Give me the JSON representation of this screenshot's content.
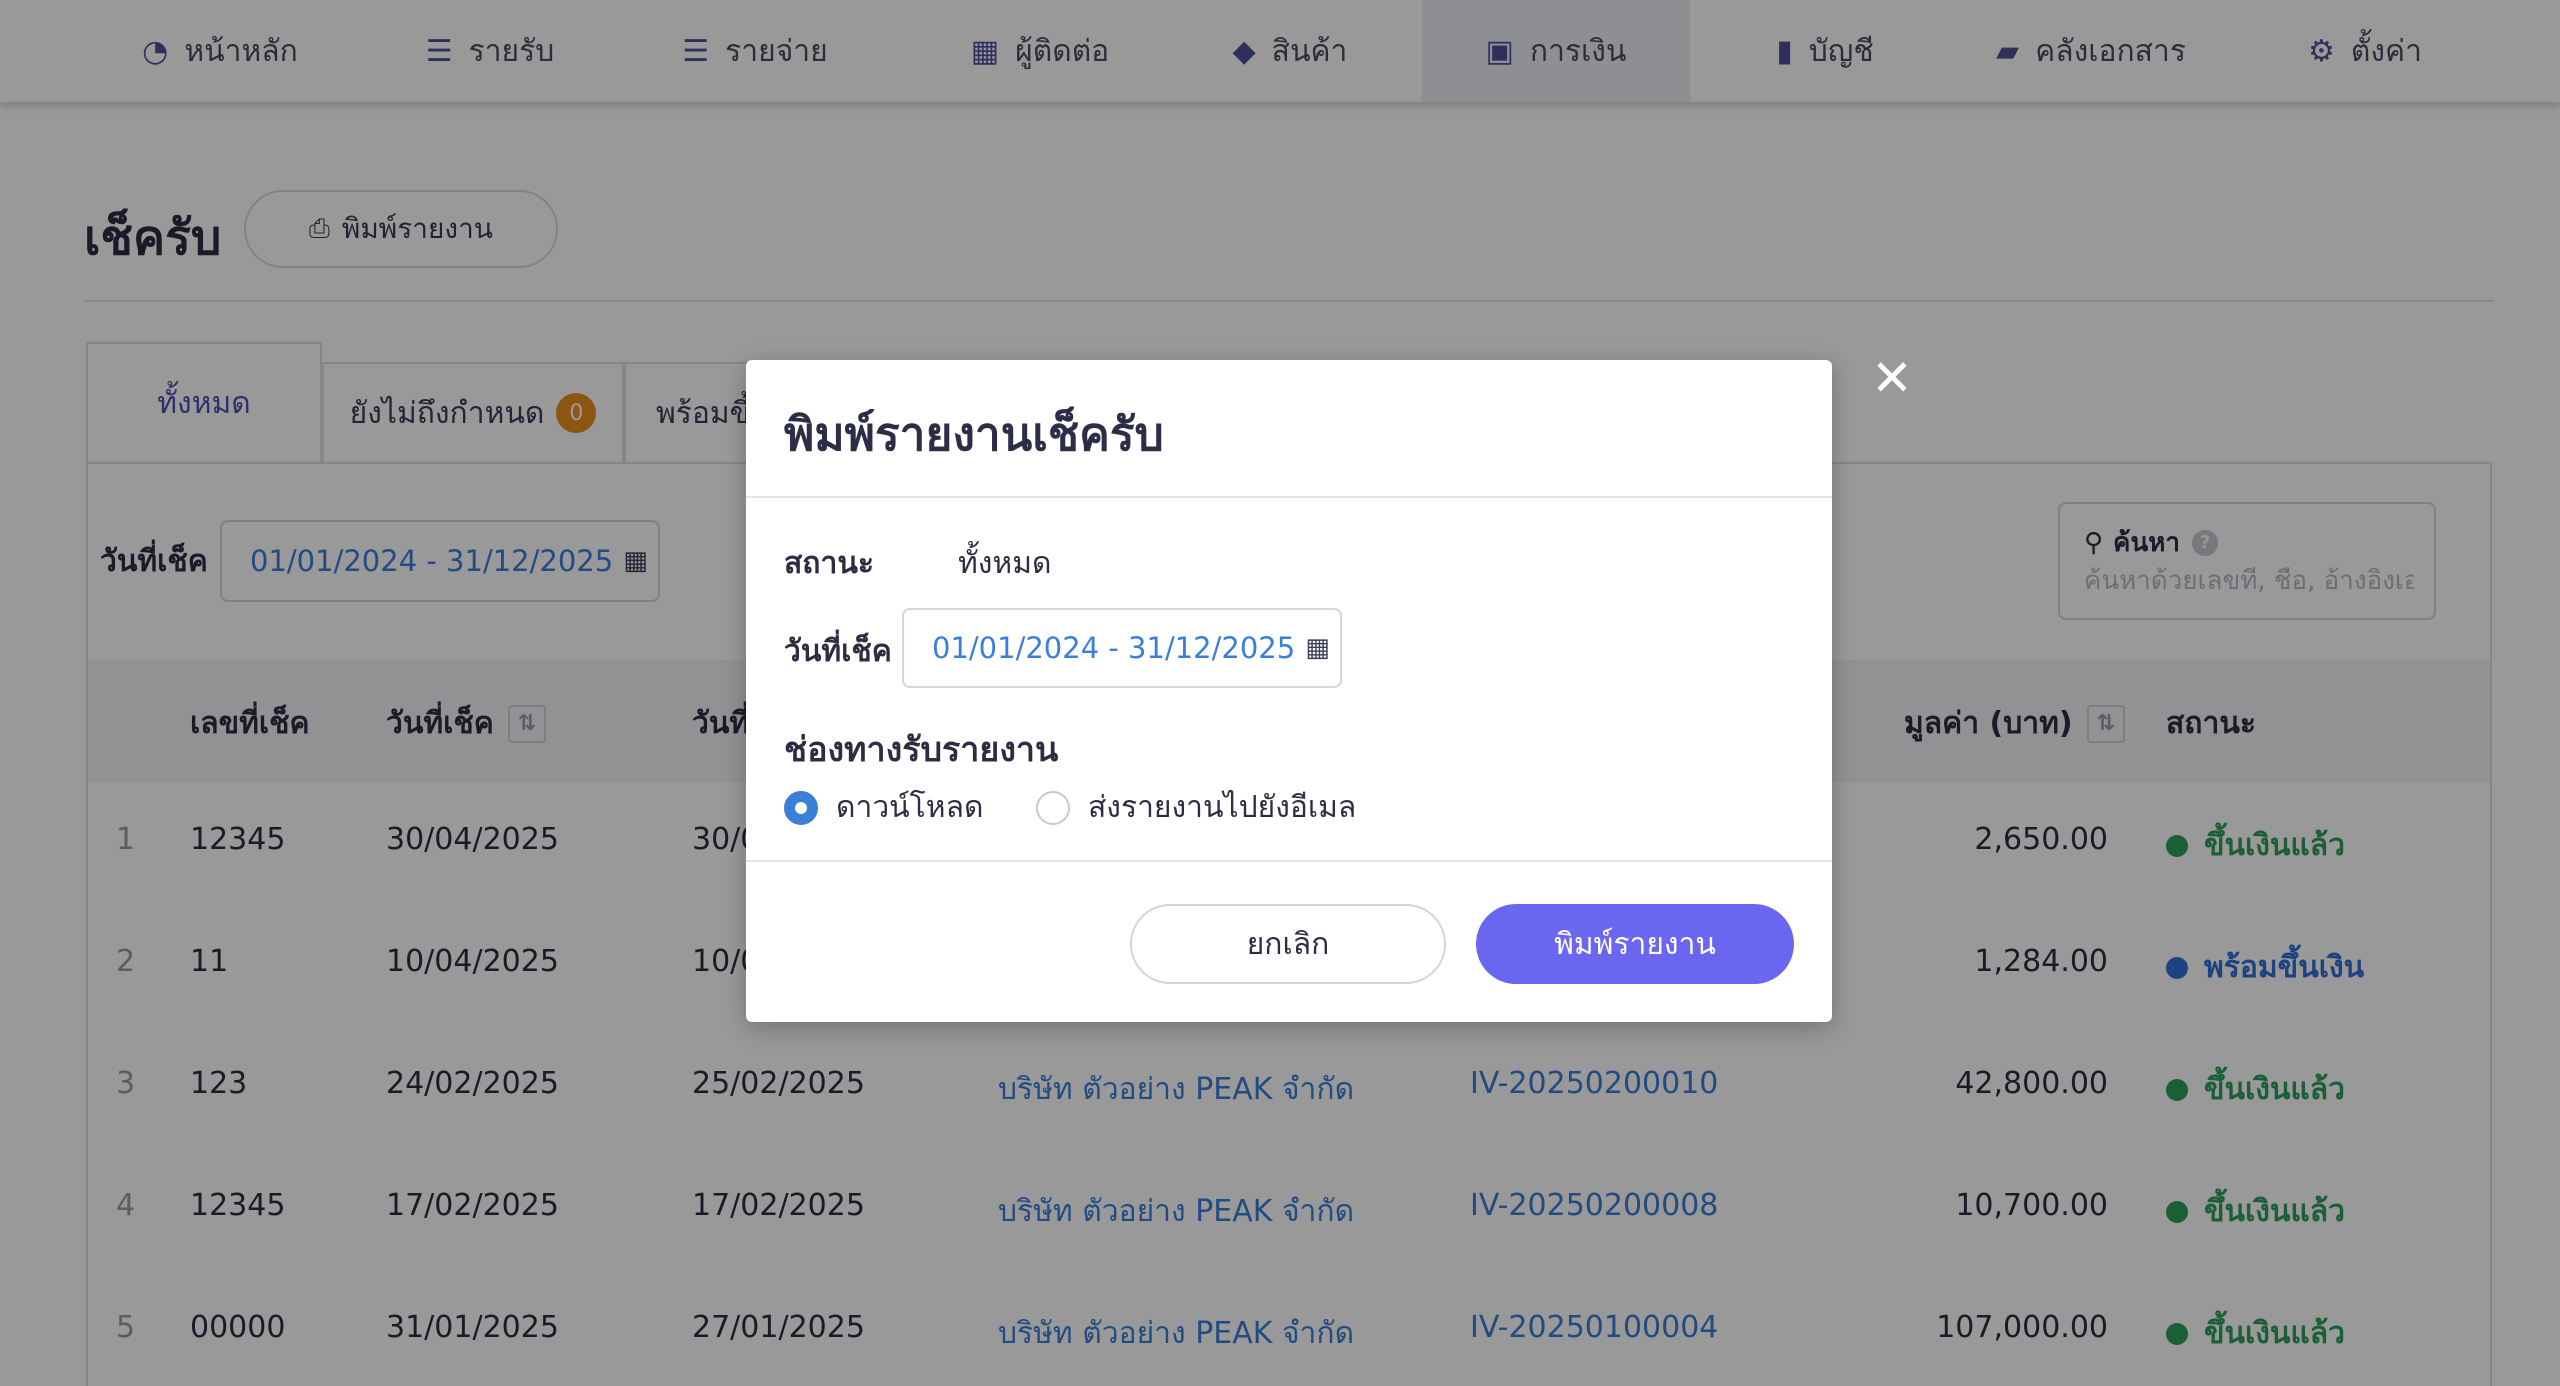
{
  "nav": {
    "items": [
      {
        "icon": "dashboard-icon",
        "glyph": "◔",
        "label": "หน้าหลัก"
      },
      {
        "icon": "income-icon",
        "glyph": "☰",
        "label": "รายรับ"
      },
      {
        "icon": "expense-icon",
        "glyph": "☰",
        "label": "รายจ่าย"
      },
      {
        "icon": "contacts-icon",
        "glyph": "▦",
        "label": "ผู้ติดต่อ"
      },
      {
        "icon": "product-box-icon",
        "glyph": "◆",
        "label": "สินค้า"
      },
      {
        "icon": "money-icon",
        "glyph": "▣",
        "label": "การเงิน",
        "active": true
      },
      {
        "icon": "ledger-book-icon",
        "glyph": "▮",
        "label": "บัญชี"
      },
      {
        "icon": "folder-icon",
        "glyph": "▰",
        "label": "คลังเอกสาร"
      },
      {
        "icon": "gear-icon",
        "glyph": "⚙",
        "label": "ตั้งค่า"
      }
    ]
  },
  "page": {
    "title": "เช็ครับ",
    "print_button": "พิมพ์รายงาน",
    "print_glyph": "⎙"
  },
  "tabs": {
    "all": "ทั้งหมด",
    "not_due": "ยังไม่ถึงกำหนด",
    "not_due_count": "0",
    "ready": "พร้อมขึ้"
  },
  "filter": {
    "date_label": "วันที่เช็ค",
    "date_range": "01/01/2024 - 31/12/2025",
    "search_label": "ค้นหา",
    "search_placeholder": "ค้นหาด้วยเลขที่, ชื่อ, อ้างอิงเอ"
  },
  "table": {
    "headers": {
      "check_no": "เลขที่เช็ค",
      "check_date": "วันที่เช็ค",
      "date2": "วันที่",
      "amount": "มูลค่า (บาท)",
      "status": "สถานะ"
    },
    "rows": [
      {
        "idx": "1",
        "no": "12345",
        "check_date": "30/04/2025",
        "date2": "30/0",
        "contact": "",
        "ref": "",
        "amount": "2,650.00",
        "status": "ขึ้นเงินแล้ว",
        "status_type": "green"
      },
      {
        "idx": "2",
        "no": "11",
        "check_date": "10/04/2025",
        "date2": "10/0",
        "contact": "",
        "ref": "",
        "amount": "1,284.00",
        "status": "พร้อมขึ้นเงิน",
        "status_type": "blue"
      },
      {
        "idx": "3",
        "no": "123",
        "check_date": "24/02/2025",
        "date2": "25/02/2025",
        "contact": "บริษัท ตัวอย่าง PEAK จำกัด",
        "ref": "IV-20250200010",
        "amount": "42,800.00",
        "status": "ขึ้นเงินแล้ว",
        "status_type": "green"
      },
      {
        "idx": "4",
        "no": "12345",
        "check_date": "17/02/2025",
        "date2": "17/02/2025",
        "contact": "บริษัท ตัวอย่าง PEAK จำกัด",
        "ref": "IV-20250200008",
        "amount": "10,700.00",
        "status": "ขึ้นเงินแล้ว",
        "status_type": "green"
      },
      {
        "idx": "5",
        "no": "00000",
        "check_date": "31/01/2025",
        "date2": "27/01/2025",
        "contact": "บริษัท ตัวอย่าง PEAK จำกัด",
        "ref": "IV-20250100004",
        "amount": "107,000.00",
        "status": "ขึ้นเงินแล้ว",
        "status_type": "green"
      }
    ]
  },
  "colors": {
    "accent": "#6b66f0",
    "link": "#3a7fd8",
    "status_green": "#2e9e5b",
    "status_blue": "#2f6fd6",
    "badge_orange": "#e98f1d"
  },
  "modal": {
    "title": "พิมพ์รายงานเช็ครับ",
    "status_label": "สถานะ",
    "status_value": "ทั้งหมด",
    "date_label": "วันที่เช็ค",
    "date_range": "01/01/2024 - 31/12/2025",
    "channel_label": "ช่องทางรับรายงาน",
    "option_download": "ดาวน์โหลด",
    "option_email": "ส่งรายงานไปยังอีเมล",
    "selected_option": "download",
    "cancel_button": "ยกเลิก",
    "print_button": "พิมพ์รายงาน",
    "close_glyph": "✕"
  }
}
